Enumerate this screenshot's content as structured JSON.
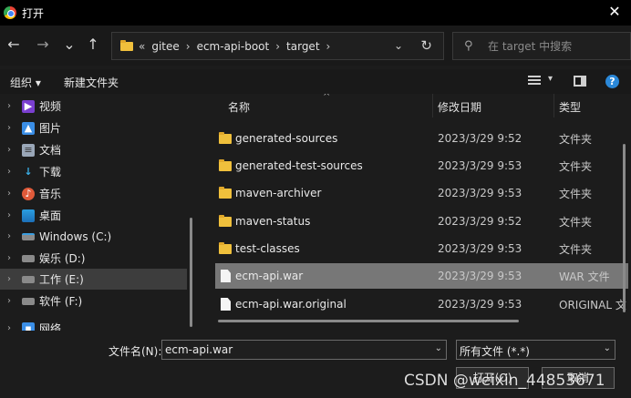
{
  "window": {
    "title": "打开",
    "close_glyph": "✕"
  },
  "nav": {
    "back_glyph": "←",
    "forward_glyph": "→",
    "recent_glyph": "⌄",
    "up_glyph": "↑",
    "overflow": "«",
    "breadcrumbs": [
      "gitee",
      "ecm-api-boot",
      "target"
    ],
    "separator": "›",
    "dropdown_glyph": "⌄",
    "refresh_glyph": "↻",
    "search_placeholder": "在 target 中搜索",
    "search_glyph": "⚲"
  },
  "toolbar": {
    "organize": "组织 ▾",
    "new_folder": "新建文件夹",
    "view_dropdown": "▾",
    "help": "?"
  },
  "sidebar": {
    "items": [
      {
        "label": "视频",
        "icon": "video-icon",
        "glyph": "▶",
        "color": "#7a3fd0",
        "arrow": "›"
      },
      {
        "label": "图片",
        "icon": "pictures-icon",
        "glyph": "▲",
        "color": "#3a8ee6",
        "arrow": "›"
      },
      {
        "label": "文档",
        "icon": "documents-icon",
        "glyph": "≡",
        "color": "#9aa7b8",
        "arrow": "›"
      },
      {
        "label": "下载",
        "icon": "downloads-icon",
        "glyph": "↓",
        "color": "#1c1c1c",
        "arrow": "›"
      },
      {
        "label": "音乐",
        "icon": "music-icon",
        "glyph": "♪",
        "color": "#e05a3a",
        "arrow": "›"
      },
      {
        "label": "桌面",
        "icon": "desktop-icon",
        "glyph": "",
        "color": "#2a9ee0",
        "arrow": "›"
      },
      {
        "label": "Windows (C:)",
        "icon": "drive-c-icon",
        "glyph": "▭",
        "color": "#7a7a7a",
        "arrow": "›"
      },
      {
        "label": "娱乐 (D:)",
        "icon": "drive-icon",
        "glyph": "▭",
        "color": "#7a7a7a",
        "arrow": "›"
      },
      {
        "label": "工作 (E:)",
        "icon": "drive-icon",
        "glyph": "▭",
        "color": "#7a7a7a",
        "arrow": "›",
        "selected": true
      },
      {
        "label": "软件 (F:)",
        "icon": "drive-icon",
        "glyph": "▭",
        "color": "#7a7a7a",
        "arrow": "›"
      },
      {
        "label": "网络",
        "icon": "network-icon",
        "glyph": "▪",
        "color": "#3a8ee6",
        "arrow": "›"
      }
    ]
  },
  "filelist": {
    "columns": {
      "name": "名称",
      "date": "修改日期",
      "type": "类型"
    },
    "sort_glyph": "^",
    "rows": [
      {
        "name": "generated-sources",
        "date": "2023/3/29 9:52",
        "type": "文件夹",
        "kind": "folder"
      },
      {
        "name": "generated-test-sources",
        "date": "2023/3/29 9:53",
        "type": "文件夹",
        "kind": "folder"
      },
      {
        "name": "maven-archiver",
        "date": "2023/3/29 9:53",
        "type": "文件夹",
        "kind": "folder"
      },
      {
        "name": "maven-status",
        "date": "2023/3/29 9:52",
        "type": "文件夹",
        "kind": "folder"
      },
      {
        "name": "test-classes",
        "date": "2023/3/29 9:53",
        "type": "文件夹",
        "kind": "folder"
      },
      {
        "name": "ecm-api.war",
        "date": "2023/3/29 9:53",
        "type": "WAR 文件",
        "kind": "file",
        "selected": true
      },
      {
        "name": "ecm-api.war.original",
        "date": "2023/3/29 9:53",
        "type": "ORIGINAL 文",
        "kind": "file"
      }
    ]
  },
  "bottom": {
    "filename_label": "文件名(N):",
    "filename_value": "ecm-api.war",
    "filetype_value": "所有文件 (*.*)",
    "dropdown_glyph": "⌄",
    "open_button": "打开(O)",
    "cancel_button": "取消"
  },
  "watermark": "CSDN @weixin_44853671"
}
